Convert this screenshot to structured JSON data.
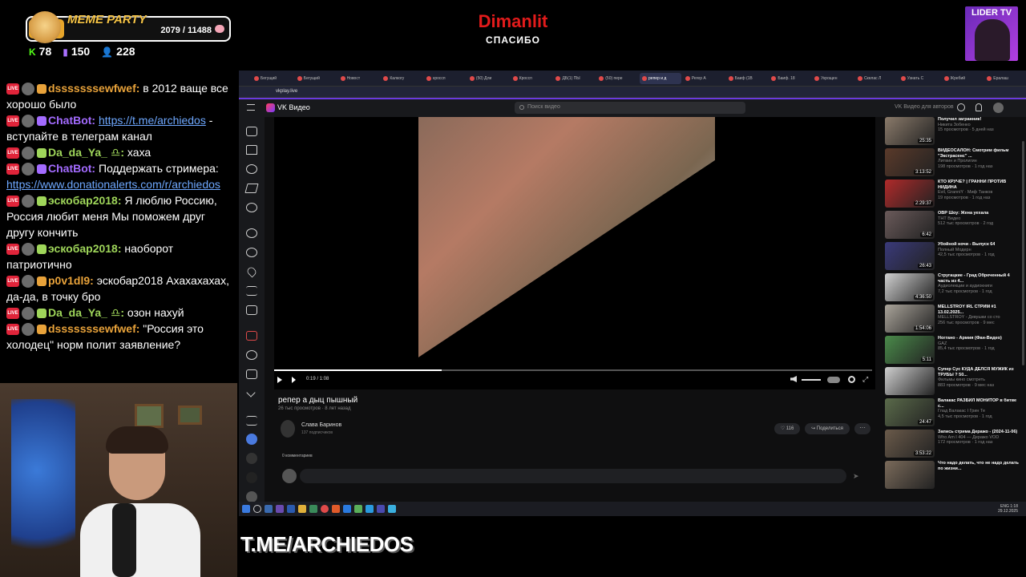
{
  "overlay": {
    "goal": {
      "title": "MEME PARTY",
      "progress": "2079 / 11488"
    },
    "stats": {
      "kick": "78",
      "twitch": "150",
      "viewers": "228"
    },
    "donor": {
      "name": "Dimanlit",
      "text": "СПАСИБО"
    },
    "channel_logo": "LIDER TV",
    "bottom_text": "T.ME/ARCHIEDOS"
  },
  "chat": [
    {
      "user": "dsssssssewfwef:",
      "color": "#e8a23a",
      "text": " в 2012 ваще все хорошо было",
      "link": ""
    },
    {
      "user": "ChatBot:",
      "color": "#a36bff",
      "text": " - вступайте в телеграм канал",
      "link": "https://t.me/archiedos"
    },
    {
      "user": "Da_da_Ya_ ♎:",
      "color": "#9fd65a",
      "text": " хаха",
      "link": ""
    },
    {
      "user": "ChatBot:",
      "color": "#a36bff",
      "text": " Поддержать стримера: ",
      "link": "https://www.donationalerts.com/r/archiedos"
    },
    {
      "user": "эскобар2018:",
      "color": "#9fd65a",
      "text": " Я люблю Россию, Россия любит меня Мы поможем друг другу кончить",
      "link": ""
    },
    {
      "user": "эскобар2018:",
      "color": "#9fd65a",
      "text": " наоборот патриотично",
      "link": ""
    },
    {
      "user": "p0v1dl9:",
      "color": "#e8a23a",
      "text": " эскобар2018 Ахахахахах, да-да, в точку бро",
      "link": ""
    },
    {
      "user": "Da_da_Ya_ ♎:",
      "color": "#9fd65a",
      "text": " озон нахуй",
      "link": ""
    },
    {
      "user": "dsssssssewfwef:",
      "color": "#e8a23a",
      "text": " \"Россия это холодец\" норм полит заявление?",
      "link": ""
    }
  ],
  "browser": {
    "tabs": [
      "Бегущий",
      "Бегущий",
      "Новост",
      "Калкогу",
      "кроссп",
      "(50) Дли",
      "Кроссп",
      "ДБ(1) ПЫ",
      "(50) пере",
      "репер и д",
      "Регер А",
      "Баиф (1В",
      "Баиф. 18",
      "Укрощен",
      "Скелас Л",
      "Узнать С",
      "Жребий",
      "Ералаш"
    ],
    "active_tab": 9,
    "url": "vkplay.live"
  },
  "vk": {
    "title": "VK Видео",
    "search_placeholder": "Поиск видео",
    "for_authors": "VK Видео для авторов",
    "video_title": "репер а дыц пышный",
    "video_meta": "26 тыс просмотров · 8 лет назад",
    "time": "0:19 / 1:08",
    "channel": "Слава Баринов",
    "subs": "137 подписчиков",
    "likes": "116",
    "share": "Поделиться",
    "comments_count": "0 комментариев",
    "progress": 0.28
  },
  "related": [
    {
      "title": "Получил загранник!",
      "channel": "Никита Зобенко",
      "meta": "15 просмотров · 5 дней наз",
      "dur": "25:35",
      "color": "#8a7a6a"
    },
    {
      "title": "ВИДЕОСАЛОН: Смотрим фильм \"Экстрасенс\" ...",
      "channel": "Литвин и Пролигин",
      "meta": "198 просмотров · 1 год наз",
      "dur": "3:13:52",
      "color": "#5a3a2a"
    },
    {
      "title": "КТО КРУЧЕ? | ГРАННИ ПРОТИВ НИДИНА",
      "channel": "Evil, GranniY · Миф Танков",
      "meta": "19 просмотров · 1 год наз",
      "dur": "2:29:37",
      "color": "#b02a2a"
    },
    {
      "title": "ОВР Шоу: Жена уехала",
      "channel": "ТНТ Видео",
      "meta": "512 тыс просмотров · 2 год",
      "dur": "6:42",
      "color": "#6a5a5a"
    },
    {
      "title": "Убойной ночи - Выпуск 64",
      "channel": "Полный Модерн",
      "meta": "42,5 тыс просмотров · 1 год",
      "dur": "26:43",
      "color": "#3a3a7a"
    },
    {
      "title": "Стругацкие - Град Обреченный 4 часть из 4...",
      "channel": "Аудиолекции и аудиокниги",
      "meta": "7,2 тыс просмотров · 1 год",
      "dur": "4:36:50",
      "color": "#d0d0d0"
    },
    {
      "title": "MELLSTROY IRL СТРИМ #1 13.02.2025...",
      "channel": "MELLSTROY - Девушки со сто",
      "meta": "256 тыс просмотров · 9 мес",
      "dur": "1:54:06",
      "color": "#aaa49a"
    },
    {
      "title": "Ноггано - Армия (Фан-Видео)",
      "channel": "GAZ",
      "meta": "85,4 тыс просмотров · 1 год",
      "dur": "5:11",
      "color": "#4a8a4a"
    },
    {
      "title": "Супер Сус КУДА ДЕЛСЯ МУЖИК из ТРУБЫ ? 50...",
      "channel": "Фильмы кино смотреть",
      "meta": "883 просмотров · 9 мес наз",
      "dur": "",
      "color": "#cfcfcf"
    },
    {
      "title": "Валакас РАЗБИЛ МОНИТОР в битве с...",
      "channel": "Глад Валакас I Грин Те",
      "meta": "4,5 тыс просмотров · 1 год",
      "dur": "24:47",
      "color": "#5a6a4a"
    },
    {
      "title": "Запись стрима Деражо - (2024-11-06)",
      "channel": "Who Am I 404 — Деражо VOD",
      "meta": "172 просмотров · 1 год наз",
      "dur": "3:53:22",
      "color": "#6a5a4a"
    },
    {
      "title": "Что надо делать, что не надо делать по жизни...",
      "channel": "",
      "meta": "",
      "dur": "",
      "color": "#7a6a5a"
    }
  ],
  "taskbar": {
    "time": "1:18",
    "date": "29.12.2025",
    "lang": "ENG"
  }
}
